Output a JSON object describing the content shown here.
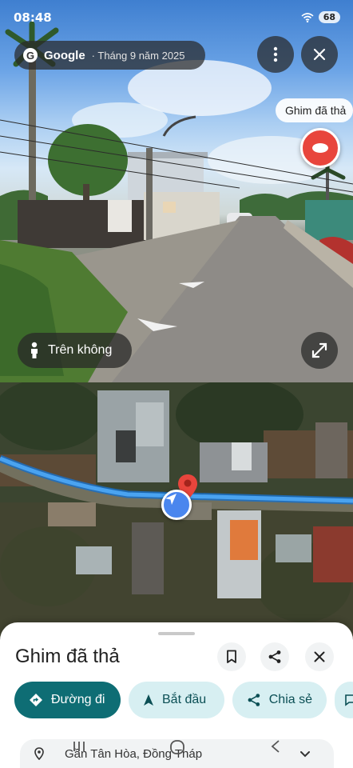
{
  "status": {
    "time": "08:48",
    "battery": "68"
  },
  "street_view": {
    "provider": "Google",
    "date": "· Tháng 9 năm 2025",
    "pin_label": "Ghim đã thả",
    "aerial_label": "Trên không"
  },
  "sheet": {
    "title": "Ghim đã thả",
    "actions": {
      "directions": "Đường đi",
      "start": "Bắt đầu",
      "share": "Chia sẻ"
    },
    "address": "Gần Tân Hòa, Đồng Tháp"
  },
  "colors": {
    "primary": "#0e6d74",
    "secondary_chip": "#d7eff2",
    "pin_red": "#e8453c",
    "route_blue": "#4aa3f0"
  }
}
